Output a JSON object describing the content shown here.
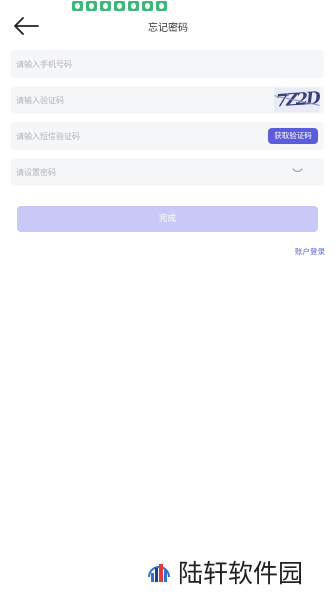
{
  "header": {
    "title": "忘记密码",
    "back_icon": "arrow-left-icon"
  },
  "status_bar": {
    "icons": [
      "app-icon",
      "app-icon",
      "app-icon",
      "app-icon",
      "app-icon",
      "app-icon",
      "app-icon"
    ],
    "icon_color": "#3cb878"
  },
  "form": {
    "phone_placeholder": "请输入手机号码",
    "captcha_placeholder": "请输入验证码",
    "captcha_text": "7Z2D",
    "sms_placeholder": "请输入短信验证码",
    "sms_button_label": "获取验证码",
    "password_placeholder": "请设置密码",
    "password_toggle_icon": "eye-closed-icon"
  },
  "actions": {
    "submit_label": "完成",
    "account_login_label": "账户登录"
  },
  "watermark": {
    "text": "陆轩软件园"
  },
  "colors": {
    "accent": "#5b5cdb",
    "submit_disabled": "#c9c8f6",
    "link": "#5a63c8",
    "field_bg": "#f5f6f8"
  }
}
